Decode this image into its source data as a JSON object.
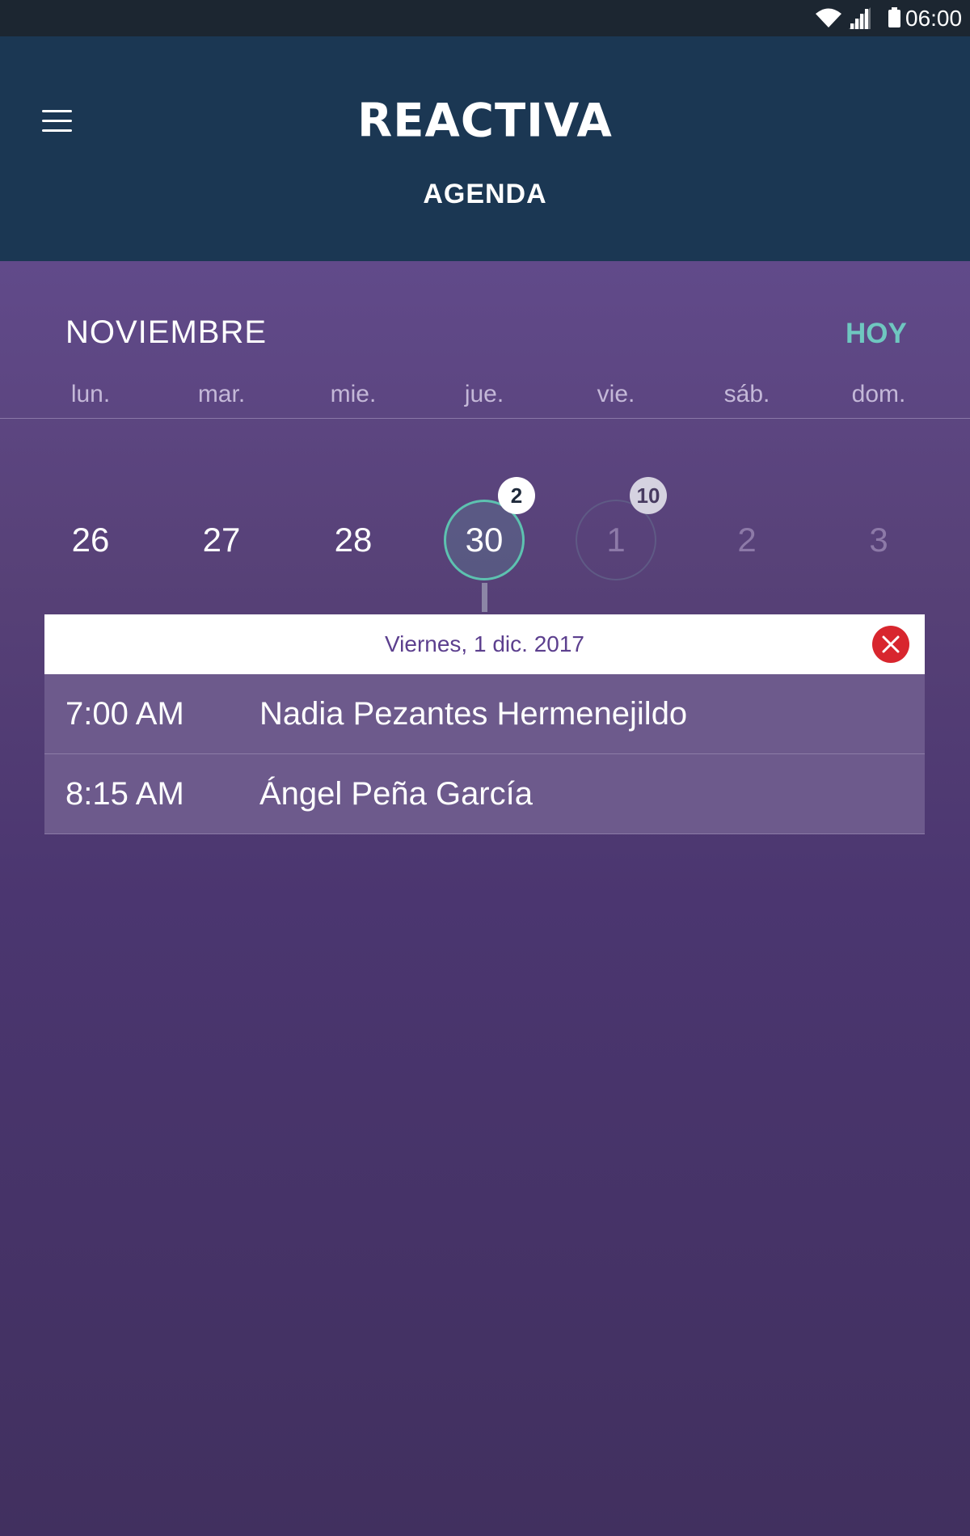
{
  "status_bar": {
    "time": "06:00",
    "icons": [
      "wifi-icon",
      "signal-icon",
      "battery-icon"
    ]
  },
  "header": {
    "logo": "REACTIVA",
    "title": "AGENDA",
    "menu_icon": "hamburger-menu-icon"
  },
  "calendar": {
    "month": "NOVIEMBRE",
    "today_label": "HOY",
    "weekdays": [
      "lun.",
      "mar.",
      "mie.",
      "jue.",
      "vie.",
      "sáb.",
      "dom."
    ],
    "days": [
      {
        "label": "26",
        "state": "normal"
      },
      {
        "label": "27",
        "state": "normal"
      },
      {
        "label": "28",
        "state": "normal"
      },
      {
        "label": "30",
        "state": "selected",
        "badge": "2"
      },
      {
        "label": "1",
        "state": "outlined",
        "badge": "10"
      },
      {
        "label": "2",
        "state": "dim"
      },
      {
        "label": "3",
        "state": "dim"
      }
    ]
  },
  "day_panel": {
    "date_label": "Viernes, 1 dic. 2017",
    "close_icon": "close-icon",
    "appointments": [
      {
        "time": "7:00 AM",
        "name": "Nadia Pezantes Hermenejildo"
      },
      {
        "time": "8:15 AM",
        "name": "Ángel Peña García"
      }
    ]
  },
  "colors": {
    "header_bg": "#1b3753",
    "status_bg": "#1c2631",
    "accent_teal": "#6fc7c0",
    "close_red": "#d8262e",
    "date_text": "#5c3f8e"
  }
}
